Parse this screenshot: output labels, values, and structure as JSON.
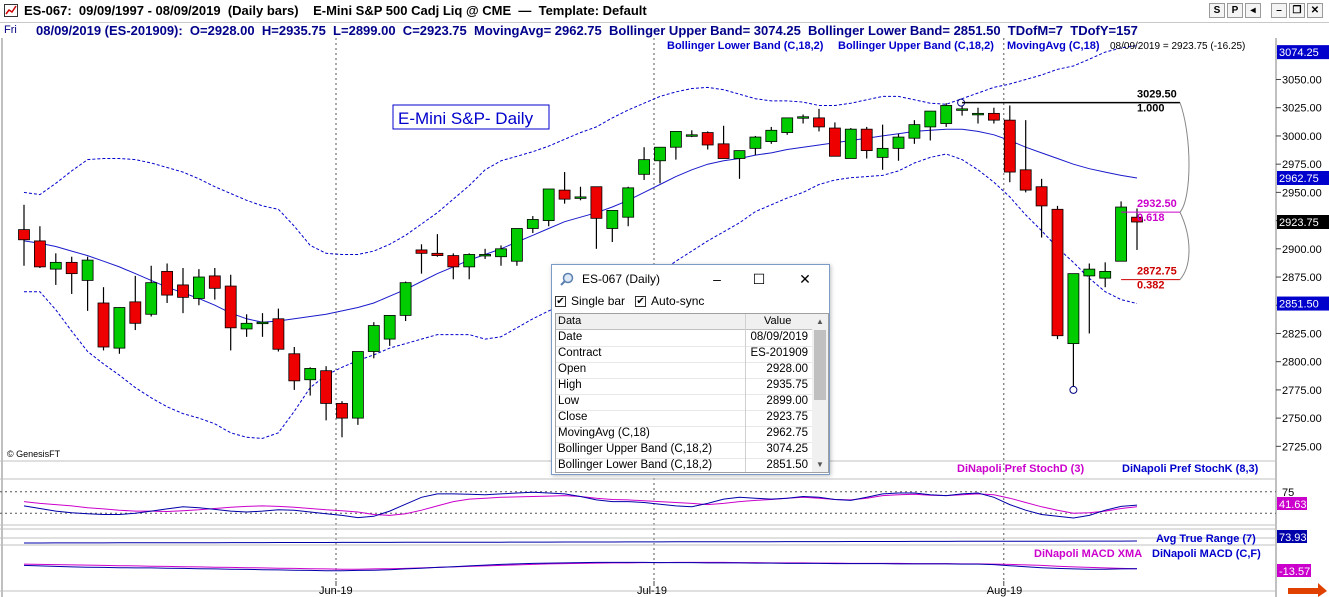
{
  "window": {
    "title": "ES-067:  09/09/1997 - 08/09/2019  (Daily bars)    E-Mini S&P 500 Cadj Liq @ CME  —  Template: Default",
    "buttons": [
      "S",
      "P",
      "◂",
      "–",
      "❐",
      "✕"
    ]
  },
  "infobar": {
    "day": "Fri",
    "text": "08/09/2019 (ES-201909):  O=2928.00  H=2935.75  L=2899.00  C=2923.75  MovingAvg= 2962.75  Bollinger Upper Band= 3074.25  Bollinger Lower Band= 2851.50  TDofM=7  TDofY=157"
  },
  "legend": {
    "lower": "Bollinger Lower Band (C,18,2)",
    "upper": "Bollinger Upper Band (C,18,2)",
    "ma": "MovingAvg (C,18)",
    "last": "08/09/2019 = 2923.75 (-16.25)"
  },
  "annotation": "E-Mini S&P- Daily",
  "copyright": "© GenesisFT",
  "colors": {
    "up": "#00cc00",
    "down": "#ee0000",
    "band": "#0000cc",
    "ma": "#1a1acc",
    "fib_top": "#000000",
    "fib_mid": "#cc00cc",
    "fib_low": "#cc0000"
  },
  "chart_data": {
    "type": "candlestick",
    "y_ticks": [
      3050,
      3025,
      3000,
      2975,
      2950,
      2925,
      2900,
      2875,
      2850,
      2825,
      2800,
      2775,
      2750,
      2725
    ],
    "y_tick_labels": [
      "3050.00",
      "3025.00",
      "3000.00",
      "2975.00",
      "2950.00",
      "2900.00",
      "2875.00",
      "2825.00",
      "2800.00",
      "2775.00",
      "2750.00",
      "2725.00"
    ],
    "y_range": [
      2712,
      3085
    ],
    "price_tags": [
      {
        "label": "3074.25",
        "value": 3074.25,
        "color": "#0000cc"
      },
      {
        "label": "2962.75",
        "value": 2962.75,
        "color": "#0000cc"
      },
      {
        "label": "2923.75",
        "value": 2923.75,
        "color": "#000000"
      },
      {
        "label": "2851.50",
        "value": 2851.5,
        "color": "#0000cc"
      }
    ],
    "x_labels": [
      {
        "label": "Jun-19",
        "index": 20
      },
      {
        "label": "Jul-19",
        "index": 40
      },
      {
        "label": "Aug-19",
        "index": 62
      }
    ],
    "candles": [
      [
        2917,
        2939,
        2885,
        2908
      ],
      [
        2907,
        2920,
        2883,
        2884
      ],
      [
        2882,
        2896,
        2868,
        2888
      ],
      [
        2888,
        2893,
        2860,
        2878
      ],
      [
        2872,
        2893,
        2845,
        2890
      ],
      [
        2852,
        2866,
        2810,
        2813
      ],
      [
        2812,
        2845,
        2807,
        2848
      ],
      [
        2853,
        2876,
        2828,
        2834
      ],
      [
        2842,
        2885,
        2840,
        2870
      ],
      [
        2880,
        2887,
        2852,
        2859
      ],
      [
        2868,
        2883,
        2843,
        2857
      ],
      [
        2856,
        2882,
        2850,
        2875
      ],
      [
        2876,
        2883,
        2855,
        2865
      ],
      [
        2867,
        2877,
        2810,
        2830
      ],
      [
        2829,
        2842,
        2822,
        2834
      ],
      [
        2834,
        2843,
        2822,
        2835
      ],
      [
        2838,
        2847,
        2809,
        2811
      ],
      [
        2807,
        2813,
        2775,
        2783
      ],
      [
        2784,
        2795,
        2770,
        2794
      ],
      [
        2792,
        2796,
        2748,
        2763
      ],
      [
        2763,
        2765,
        2733,
        2750
      ],
      [
        2750,
        2809,
        2744,
        2809
      ],
      [
        2809,
        2835,
        2803,
        2832
      ],
      [
        2820,
        2838,
        2814,
        2841
      ],
      [
        2841,
        2871,
        2836,
        2870
      ],
      [
        2899,
        2904,
        2878,
        2896
      ],
      [
        2896,
        2913,
        2893,
        2894
      ],
      [
        2894,
        2896,
        2873,
        2884
      ],
      [
        2884,
        2896,
        2873,
        2895
      ],
      [
        2895,
        2900,
        2891,
        2895
      ],
      [
        2893,
        2903,
        2885,
        2900
      ],
      [
        2889,
        2912,
        2885,
        2918
      ],
      [
        2918,
        2929,
        2914,
        2926
      ],
      [
        2925,
        2952,
        2920,
        2953
      ],
      [
        2952,
        2968,
        2940,
        2944
      ],
      [
        2945,
        2955,
        2943,
        2946
      ],
      [
        2955,
        2955,
        2900,
        2927
      ],
      [
        2918,
        2932,
        2906,
        2934
      ],
      [
        2928,
        2955,
        2920,
        2954
      ],
      [
        2966,
        2990,
        2961,
        2979
      ],
      [
        2978,
        2990,
        2958,
        2990
      ],
      [
        2990,
        3004,
        2979,
        3004
      ],
      [
        3000,
        3005,
        2999,
        3001
      ],
      [
        3003,
        3004,
        2988,
        2992
      ],
      [
        2993,
        3009,
        2991,
        2980
      ],
      [
        2980,
        2985,
        2962,
        2987
      ],
      [
        2989,
        3000,
        2983,
        2999
      ],
      [
        2995,
        3008,
        2993,
        3005
      ],
      [
        3003,
        3016,
        3001,
        3016
      ],
      [
        3016,
        3019,
        3011,
        3017
      ],
      [
        3016,
        3024,
        3004,
        3008
      ],
      [
        3007,
        3012,
        2982,
        2982
      ],
      [
        2980,
        3007,
        2982,
        3006
      ],
      [
        3006,
        3008,
        2980,
        2987
      ],
      [
        2981,
        3010,
        2970,
        2989
      ],
      [
        2989,
        3002,
        2978,
        2999
      ],
      [
        2998,
        3014,
        2993,
        3010
      ],
      [
        3008,
        3022,
        2996,
        3022
      ],
      [
        3011,
        3029,
        3008,
        3027
      ],
      [
        3024,
        3029.5,
        3018,
        3024
      ],
      [
        3020,
        3025,
        3011,
        3020
      ],
      [
        3020,
        3025,
        3011,
        3014
      ],
      [
        3014,
        3027,
        2959,
        2968
      ],
      [
        2970,
        3014,
        2950,
        2952
      ],
      [
        2955,
        2962,
        2910,
        2938
      ],
      [
        2935,
        2938,
        2820,
        2823
      ],
      [
        2816,
        2878,
        2775,
        2878
      ],
      [
        2876,
        2887,
        2825,
        2882
      ],
      [
        2874,
        2888,
        2866,
        2880
      ],
      [
        2889,
        2942,
        2889,
        2937
      ],
      [
        2928,
        2935.75,
        2899,
        2923.75
      ]
    ],
    "moving_avg": [
      2907,
      2905,
      2902,
      2898,
      2894,
      2889,
      2884,
      2878,
      2872,
      2866,
      2861,
      2856,
      2850,
      2843,
      2838,
      2835,
      2836,
      2838,
      2840,
      2842,
      2845,
      2848,
      2852,
      2858,
      2864,
      2871,
      2878,
      2884,
      2890,
      2895,
      2900,
      2906,
      2912,
      2918,
      2924,
      2928,
      2932,
      2937,
      2943,
      2950,
      2957,
      2964,
      2970,
      2975,
      2978,
      2980,
      2983,
      2985,
      2988,
      2990,
      2992,
      2994,
      2996,
      2998,
      3000,
      3002,
      3004,
      3005,
      3006,
      3006,
      3004,
      3001,
      2996,
      2990,
      2985,
      2980,
      2975,
      2971,
      2968,
      2965,
      2962.75
    ],
    "bb_upper": [
      2950,
      2948,
      2958,
      2969,
      2979,
      2980,
      2980,
      2979,
      2976,
      2972,
      2968,
      2962,
      2955,
      2949,
      2943,
      2938,
      2935,
      2920,
      2903,
      2896,
      2895,
      2895,
      2898,
      2904,
      2912,
      2922,
      2932,
      2944,
      2956,
      2970,
      2978,
      2982,
      2986,
      2991,
      2997,
      3003,
      3008,
      3016,
      3023,
      3029,
      3035,
      3039,
      3042,
      3043,
      3041,
      3037,
      3033,
      3031,
      3031,
      3030,
      3027,
      3027,
      3029,
      3032,
      3035,
      3035,
      3032,
      3029,
      3028,
      3033,
      3038,
      3043,
      3046,
      3050,
      3054,
      3059,
      3062,
      3068,
      3074.25,
      3078,
      3080
    ],
    "bb_lower": [
      2862,
      2862,
      2846,
      2827,
      2809,
      2798,
      2788,
      2777,
      2768,
      2760,
      2754,
      2750,
      2745,
      2737,
      2733,
      2732,
      2737,
      2756,
      2777,
      2788,
      2795,
      2801,
      2806,
      2812,
      2816,
      2820,
      2824,
      2824,
      2824,
      2820,
      2822,
      2830,
      2838,
      2845,
      2851,
      2853,
      2856,
      2858,
      2863,
      2871,
      2879,
      2889,
      2898,
      2907,
      2915,
      2923,
      2933,
      2939,
      2945,
      2950,
      2957,
      2961,
      2963,
      2964,
      2965,
      2969,
      2976,
      2981,
      2984,
      2979,
      2970,
      2959,
      2946,
      2930,
      2916,
      2901,
      2888,
      2874,
      2862,
      2855,
      2851.5
    ],
    "fib": [
      {
        "price_label": "3029.50",
        "ratio_label": "1.000",
        "value": 3029.5,
        "color": "#000000"
      },
      {
        "price_label": "2932.50",
        "ratio_label": "0.618",
        "value": 2932.5,
        "color": "#cc00cc"
      },
      {
        "price_label": "2872.75",
        "ratio_label": "0.382",
        "value": 2872.75,
        "color": "#cc0000"
      }
    ],
    "stoch": {
      "legend": [
        "DiNapoli Pref StochD (3)",
        "DiNapoli Pref StochK (8,3)"
      ],
      "tick_label": "75",
      "value_label": "41.63",
      "d_values": [
        52,
        48,
        45,
        42,
        38,
        35,
        32,
        30,
        30,
        29,
        31,
        33,
        36,
        39,
        41,
        42,
        41,
        39,
        36,
        33,
        31,
        28,
        22,
        20,
        24,
        32,
        42,
        52,
        58,
        60,
        62,
        63,
        64,
        65,
        66,
        64,
        60,
        57,
        56,
        54,
        52,
        50,
        48,
        45,
        48,
        52,
        55,
        57,
        60,
        62,
        60,
        57,
        56,
        60,
        66,
        68,
        69,
        67,
        66,
        68,
        70,
        68,
        60,
        50,
        40,
        32,
        25,
        26,
        30,
        36,
        40
      ],
      "k_values": [
        42,
        36,
        30,
        26,
        24,
        22,
        22,
        25,
        30,
        35,
        40,
        38,
        34,
        30,
        28,
        30,
        33,
        32,
        28,
        24,
        20,
        15,
        18,
        30,
        46,
        62,
        70,
        70,
        69,
        68,
        70,
        72,
        74,
        72,
        70,
        64,
        56,
        52,
        52,
        50,
        46,
        42,
        40,
        48,
        58,
        62,
        60,
        58,
        60,
        64,
        62,
        57,
        55,
        62,
        70,
        72,
        72,
        68,
        66,
        70,
        72,
        62,
        45,
        32,
        22,
        18,
        14,
        20,
        32,
        41,
        44
      ]
    },
    "atr": {
      "legend": "Avg True Range (7)",
      "value_label": "73.93"
    },
    "macd": {
      "legend": [
        "DiNapoli MACD XMA",
        "DiNapoli MACD (C,F)"
      ],
      "value_label": "-13.57",
      "xma_values": [
        55,
        54,
        53,
        52,
        51,
        50,
        49,
        48,
        47,
        46,
        45,
        44,
        43,
        42,
        41,
        40,
        39,
        38,
        37,
        36,
        35,
        35,
        36,
        37,
        38,
        40,
        42,
        44,
        46,
        48,
        50,
        52,
        54,
        56,
        57,
        58,
        59,
        60,
        60,
        61,
        61,
        62,
        62,
        62,
        62,
        61,
        61,
        60,
        60,
        60,
        59,
        59,
        58,
        58,
        58,
        58,
        57,
        57,
        57,
        56,
        56,
        55,
        54,
        52,
        50,
        47,
        44,
        42,
        40,
        38,
        37
      ],
      "macd_values": [
        50,
        48,
        46,
        44,
        43,
        42,
        41,
        40,
        40,
        39,
        38,
        37,
        36,
        35,
        34,
        33,
        32,
        31,
        30,
        29,
        29,
        30,
        31,
        33,
        36,
        39,
        42,
        45,
        48,
        51,
        54,
        56,
        58,
        59,
        60,
        61,
        62,
        62,
        62,
        62,
        61,
        61,
        61,
        60,
        60,
        60,
        59,
        59,
        58,
        58,
        58,
        57,
        57,
        57,
        57,
        56,
        56,
        56,
        56,
        55,
        55,
        53,
        49,
        45,
        41,
        38,
        36,
        35,
        35,
        36,
        37
      ]
    }
  },
  "dialog": {
    "title": "ES-067 (Daily)",
    "single_bar": "Single bar",
    "auto_sync": "Auto-sync",
    "col_data": "Data",
    "col_value": "Value",
    "rows": [
      {
        "label": "Date",
        "value": "08/09/2019"
      },
      {
        "label": "Contract",
        "value": "ES-201909"
      },
      {
        "label": "Open",
        "value": "2928.00"
      },
      {
        "label": "High",
        "value": "2935.75"
      },
      {
        "label": "Low",
        "value": "2899.00"
      },
      {
        "label": "Close",
        "value": "2923.75"
      },
      {
        "label": "MovingAvg (C,18)",
        "value": "2962.75"
      },
      {
        "label": "Bollinger Upper Band (C,18,2)",
        "value": "3074.25"
      },
      {
        "label": "Bollinger Lower Band (C,18,2)",
        "value": "2851.50"
      }
    ]
  }
}
